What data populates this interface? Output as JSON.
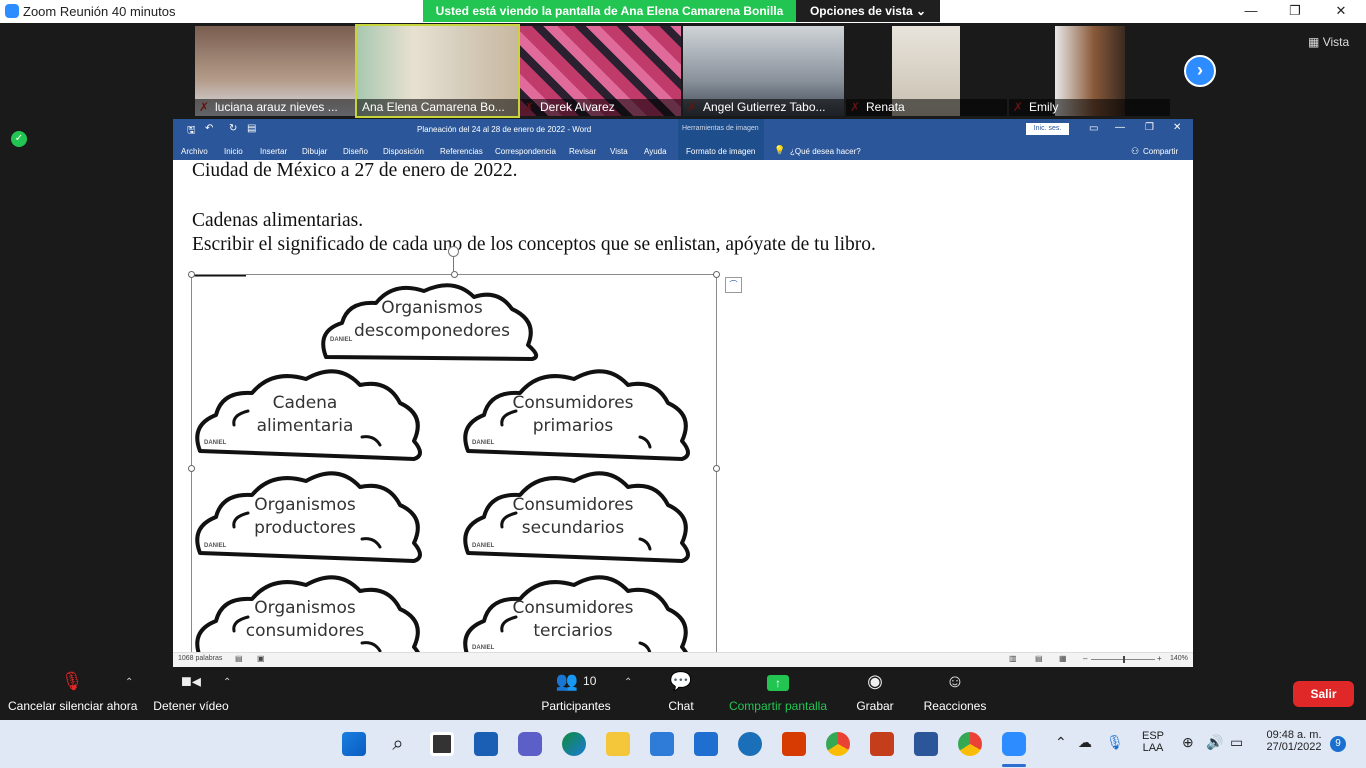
{
  "zoom": {
    "window_title": "Zoom Reunión 40 minutos",
    "share_banner": "Usted está viendo la pantalla de Ana Elena Camarena Bonilla",
    "view_options": "Opciones de vista",
    "view_button": "Vista",
    "participants": [
      {
        "name": "luciana arauz nieves ...",
        "color": "#8a7060"
      },
      {
        "name": "Ana Elena Camarena Bo...",
        "color": "#c9c2b0",
        "active": true
      },
      {
        "name": "Derek  Alvarez",
        "color": "#b04a6a"
      },
      {
        "name": "Angel Gutierrez Tabo...",
        "color": "#6e7680"
      },
      {
        "name": "Renata",
        "color": "#3a3a3a"
      },
      {
        "name": "Emily",
        "color": "#4a3a30"
      }
    ],
    "toolbar": {
      "unmute": "Cancelar silenciar ahora",
      "stop_video": "Detener vídeo",
      "participants": "Participantes",
      "participants_count": "10",
      "chat": "Chat",
      "share": "Compartir pantalla",
      "record": "Grabar",
      "reactions": "Reacciones",
      "exit": "Salir"
    },
    "colors": {
      "accent": "#2d8cff",
      "share_green": "#23c552",
      "exit_red": "#e02828"
    }
  },
  "word": {
    "title": "Planeación del 24 al 28 de enero de 2022  -  Word",
    "image_tools": "Herramientas de imagen",
    "sign_in": "Inic. ses.",
    "tabs": [
      "Archivo",
      "Inicio",
      "Insertar",
      "Dibujar",
      "Diseño",
      "Disposición",
      "Referencias",
      "Correspondencia",
      "Revisar",
      "Vista",
      "Ayuda"
    ],
    "format_tab": "Formato de imagen",
    "tell_me": "¿Qué desea hacer?",
    "share": "Compartir",
    "doc_lines": [
      "Ciudad de México a 27 de enero de 2022.",
      "Cadenas alimentarias.",
      "Escribir el significado de cada uno de los conceptos que se enlistan, apóyate de tu libro."
    ],
    "clouds": [
      {
        "line1": "Organismos",
        "line2": "descomponedores"
      },
      {
        "line1": "Cadena",
        "line2": "alimentaria"
      },
      {
        "line1": "Consumidores",
        "line2": "primarios"
      },
      {
        "line1": "Organismos",
        "line2": "productores"
      },
      {
        "line1": "Consumidores",
        "line2": "secundarios"
      },
      {
        "line1": "Organismos",
        "line2": "consumidores"
      },
      {
        "line1": "Consumidores",
        "line2": "terciarios"
      }
    ],
    "watermark": "DANIEL",
    "status": {
      "words": "1068 palabras",
      "zoom": "140%"
    },
    "colors": {
      "ribbon": "#2b579a"
    }
  },
  "taskbar": {
    "lang1": "ESP",
    "lang2": "LAA",
    "time": "09:48 a. m.",
    "date": "27/01/2022",
    "notifications": "9"
  }
}
